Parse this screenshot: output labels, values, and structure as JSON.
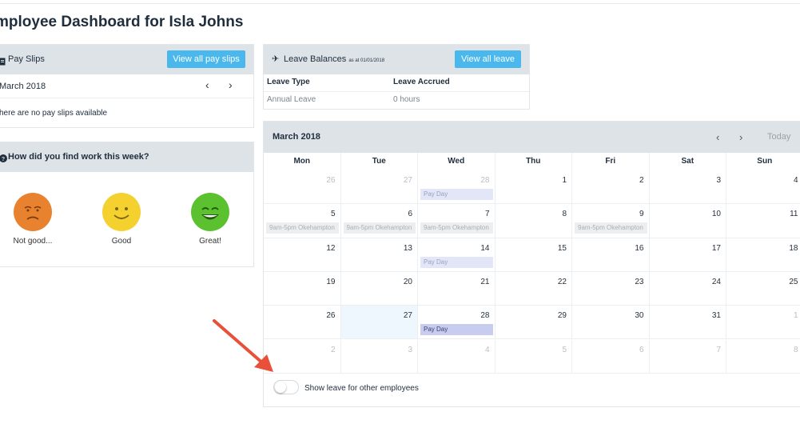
{
  "page": {
    "title": "mployee Dashboard for Isla Johns"
  },
  "payslips": {
    "title": "Pay Slips",
    "icon": "document-icon",
    "view_all": "View all pay slips",
    "month": "March 2018",
    "prev": "‹",
    "next": "›",
    "empty": "here are no pay slips available"
  },
  "feedback": {
    "title": "How did you find work this week?",
    "icon": "help-circle-icon",
    "options": [
      {
        "label": "Not good...",
        "color": "#e8822f"
      },
      {
        "label": "Good",
        "color": "#f5d12f"
      },
      {
        "label": "Great!",
        "color": "#5cc12f"
      }
    ]
  },
  "leave": {
    "title": "Leave Balances",
    "as_at": "as at 01/01/2018",
    "icon": "airplane-icon",
    "view_all": "View all leave",
    "headers": [
      "Leave Type",
      "Leave Accrued"
    ],
    "rows": [
      [
        "Annual Leave",
        "0 hours"
      ]
    ]
  },
  "calendar": {
    "title": "March 2018",
    "prev": "‹",
    "next": "›",
    "today": "Today",
    "days": [
      "Mon",
      "Tue",
      "Wed",
      "Thu",
      "Fri",
      "Sat",
      "Sun"
    ],
    "weeks": [
      [
        {
          "d": "26",
          "other": true
        },
        {
          "d": "27",
          "other": true
        },
        {
          "d": "28",
          "other": true,
          "event": "Pay Day",
          "type": "payday"
        },
        {
          "d": "1"
        },
        {
          "d": "2"
        },
        {
          "d": "3"
        },
        {
          "d": "4"
        }
      ],
      [
        {
          "d": "5",
          "event": "9am-5pm Okehampton",
          "type": "shift"
        },
        {
          "d": "6",
          "event": "9am-5pm Okehampton",
          "type": "shift"
        },
        {
          "d": "7",
          "event": "9am-5pm Okehampton",
          "type": "shift"
        },
        {
          "d": "8"
        },
        {
          "d": "9",
          "event": "9am-5pm Okehampton",
          "type": "shift"
        },
        {
          "d": "10"
        },
        {
          "d": "11"
        }
      ],
      [
        {
          "d": "12"
        },
        {
          "d": "13"
        },
        {
          "d": "14",
          "event": "Pay Day",
          "type": "payday"
        },
        {
          "d": "15"
        },
        {
          "d": "16"
        },
        {
          "d": "17"
        },
        {
          "d": "18"
        }
      ],
      [
        {
          "d": "19"
        },
        {
          "d": "20"
        },
        {
          "d": "21"
        },
        {
          "d": "22"
        },
        {
          "d": "23"
        },
        {
          "d": "24"
        },
        {
          "d": "25"
        }
      ],
      [
        {
          "d": "26"
        },
        {
          "d": "27",
          "today": true
        },
        {
          "d": "28",
          "event": "Pay Day",
          "type": "payday strong"
        },
        {
          "d": "29"
        },
        {
          "d": "30"
        },
        {
          "d": "31"
        },
        {
          "d": "1",
          "other": true
        }
      ],
      [
        {
          "d": "2",
          "other": true
        },
        {
          "d": "3",
          "other": true
        },
        {
          "d": "4",
          "other": true
        },
        {
          "d": "5",
          "other": true
        },
        {
          "d": "6",
          "other": true
        },
        {
          "d": "7",
          "other": true
        },
        {
          "d": "8",
          "other": true
        }
      ]
    ],
    "toggle_label": "Show leave for other employees",
    "toggle_on": false
  },
  "colors": {
    "accent": "#4ab8ec",
    "header": "#dde3e7",
    "arrow": "#e8503a"
  }
}
